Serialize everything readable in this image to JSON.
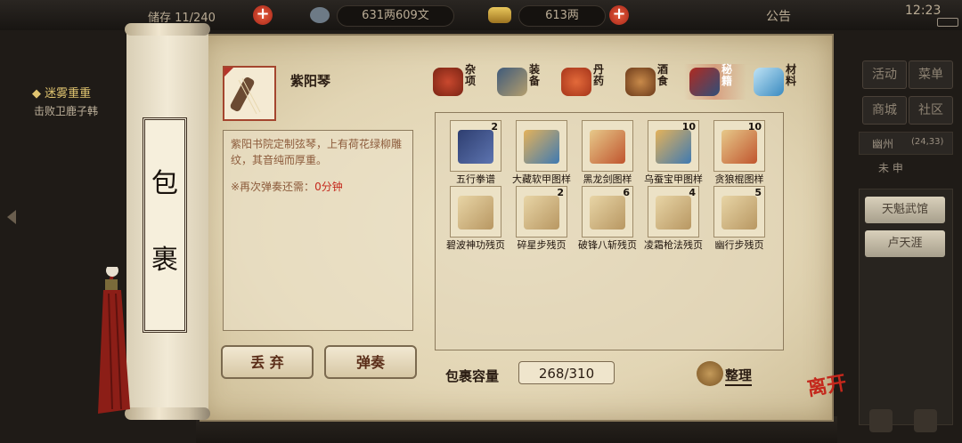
{
  "topbar": {
    "slots_label": "储存 11/240",
    "money": "631两609文",
    "gold": "613两",
    "notice_label": "公告",
    "clock": "12:23"
  },
  "quest": {
    "title": "◆ 迷雾重重",
    "subtitle": "击败卫鹿子韩"
  },
  "scroll": {
    "title_chars": [
      "包",
      "裹"
    ]
  },
  "item": {
    "name": "紫阳琴",
    "description": "紫阳书院定制弦琴，上有荷花绿柳雕纹，其音纯而厚重。",
    "cooldown_label": "※再次弹奏还需：",
    "cooldown_value": "0分钟",
    "discard_label": "丢 弃",
    "play_label": "弹奏"
  },
  "tabs": [
    {
      "label": "杂项",
      "icon": "jar-icon"
    },
    {
      "label": "装备",
      "icon": "sword-icon"
    },
    {
      "label": "丹药",
      "icon": "pills-icon"
    },
    {
      "label": "酒食",
      "icon": "food-icon"
    },
    {
      "label": "秘籍",
      "icon": "book-icon",
      "active": true
    },
    {
      "label": "材料",
      "icon": "crystal-icon"
    }
  ],
  "slots": [
    {
      "label": "五行拳谱",
      "count": "2",
      "kind": "book"
    },
    {
      "label": "大藏软甲图样",
      "count": "",
      "kind": "scroll"
    },
    {
      "label": "黑龙剑图样",
      "count": "",
      "kind": "scroll2"
    },
    {
      "label": "乌蚕宝甲图样",
      "count": "10",
      "kind": "scroll"
    },
    {
      "label": "贪狼棍图样",
      "count": "10",
      "kind": "scroll2"
    },
    {
      "label": "碧波神功残页",
      "count": "",
      "kind": "page"
    },
    {
      "label": "碎星步残页",
      "count": "2",
      "kind": "page"
    },
    {
      "label": "破锋八斩残页",
      "count": "6",
      "kind": "page"
    },
    {
      "label": "凌霜枪法残页",
      "count": "4",
      "kind": "page"
    },
    {
      "label": "幽行步残页",
      "count": "5",
      "kind": "page"
    }
  ],
  "capacity": {
    "label": "包裹容量",
    "value": "268/310"
  },
  "sort_label": "整理",
  "right_panel": {
    "buttons": [
      "活动",
      "菜单",
      "商城",
      "社区"
    ],
    "location": "幽州",
    "coords": "(24,33)",
    "time_label": "未 申",
    "list": [
      "天魁武馆",
      "卢天涯"
    ]
  },
  "leave_label": "离开",
  "colors": {
    "accent_red": "#c4281c",
    "paper": "#e6dbbd",
    "border": "#8d7b5d"
  }
}
